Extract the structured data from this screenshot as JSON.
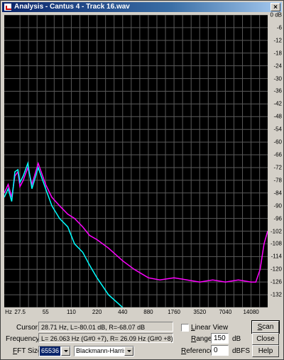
{
  "window": {
    "title": "Analysis - Cantus 4 - Track 16.wav",
    "close_glyph": "×"
  },
  "chart_data": {
    "type": "line",
    "xlabel": "",
    "ylabel": "",
    "x_scale": "log",
    "x_unit": "Hz",
    "xlim": [
      18,
      22050
    ],
    "ylim": [
      -138,
      0
    ],
    "grid": true,
    "x_ticks": [
      "Hz",
      "27.5",
      "55",
      "110",
      "220",
      "440",
      "880",
      "1760",
      "3520",
      "7040",
      "14080"
    ],
    "y_ticks": [
      "0 dB",
      "-6",
      "-12",
      "-18",
      "-24",
      "-30",
      "-36",
      "-42",
      "-48",
      "-54",
      "-60",
      "-66",
      "-72",
      "-78",
      "-84",
      "-90",
      "-96",
      "-102",
      "-108",
      "-114",
      "-120",
      "-126",
      "-132"
    ],
    "series": [
      {
        "name": "L",
        "color": "#ff00ff",
        "x": [
          18,
          20,
          22,
          24,
          26,
          27.5,
          30,
          34,
          38,
          45,
          55,
          65,
          80,
          100,
          120,
          150,
          180,
          220,
          300,
          440,
          600,
          880,
          1200,
          1760,
          2500,
          3520,
          5000,
          7040,
          10000,
          14080,
          16000,
          18000,
          20000,
          22050
        ],
        "y": [
          -84,
          -80,
          -86,
          -76,
          -74,
          -81,
          -78,
          -72,
          -80,
          -70,
          -80,
          -86,
          -90,
          -94,
          -96,
          -100,
          -104,
          -106,
          -110,
          -116,
          -120,
          -124,
          -125,
          -124,
          -125,
          -126,
          -125,
          -126,
          -125,
          -126,
          -126,
          -120,
          -108,
          -102
        ]
      },
      {
        "name": "R",
        "color": "#00ffff",
        "x": [
          18,
          20,
          22,
          24,
          26,
          27.5,
          30,
          34,
          38,
          45,
          55,
          65,
          80,
          100,
          120,
          150,
          180,
          220,
          300,
          440
        ],
        "y": [
          -86,
          -82,
          -88,
          -74,
          -73,
          -79,
          -76,
          -70,
          -82,
          -72,
          -82,
          -90,
          -96,
          -100,
          -108,
          -112,
          -118,
          -124,
          -132,
          -138
        ]
      }
    ]
  },
  "controls": {
    "cursor_label": "Cursor:",
    "cursor_value": "28.71 Hz, L=-80.01 dB, R=-68.07 dB",
    "frequency_label": "Frequency:",
    "frequency_value": "L= 26.063 Hz (G#0 +7), R=  26.09 Hz (G#0 +8)",
    "fft_label_hotkey": "F",
    "fft_label_rest": "FT Size:",
    "fft_size": "65536",
    "window_func": "Blackmann-Harris",
    "linear_view_hotkey": "L",
    "linear_view_rest": "inear View",
    "range_hotkey": "R",
    "range_rest": "ange",
    "range_value": "150",
    "range_unit": "dB",
    "reference_hotkey": "R",
    "reference_rest": "eference",
    "reference_value": "0",
    "reference_unit": "dBFS",
    "scan_hotkey": "S",
    "scan_rest": "can",
    "close_label": "Close",
    "help_label": "Help"
  }
}
